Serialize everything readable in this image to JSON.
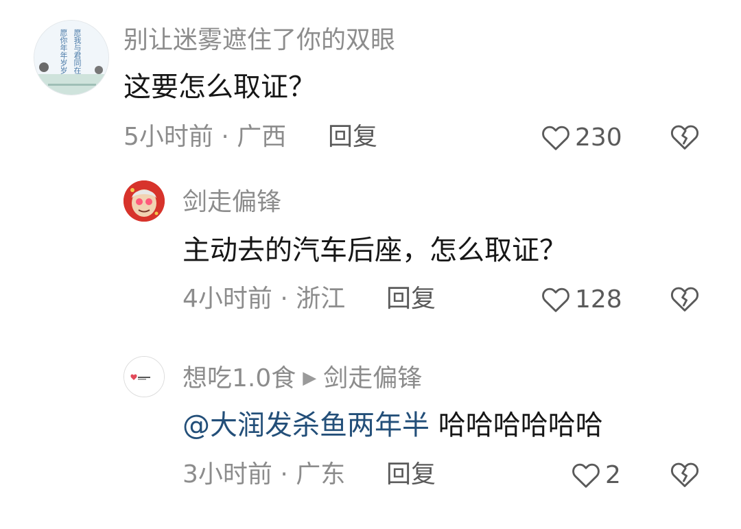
{
  "comments": [
    {
      "user": "别让迷雾遮住了你的双眼",
      "avatar_text": [
        "愿你年年岁岁",
        "愿我与君同在"
      ],
      "text": "这要怎么取证？",
      "time": "5小时前",
      "location": "广西",
      "reply_label": "回复",
      "likes": "230"
    },
    {
      "user": "剑走偏锋",
      "text": "主动去的汽车后座，怎么取证？",
      "time": "4小时前",
      "location": "浙江",
      "reply_label": "回复",
      "likes": "128"
    },
    {
      "user": "想吃1.0食",
      "reply_to": "剑走偏锋",
      "mention": "@大润发杀鱼两年半",
      "text": " 哈哈哈哈哈哈",
      "time": "3小时前",
      "location": "广东",
      "reply_label": "回复",
      "likes": "2"
    }
  ],
  "meta_separator": " · ",
  "colors": {
    "meta": "#8c8c8c",
    "text": "#161616",
    "mention": "#234f79",
    "icon": "#5a5a5a"
  }
}
